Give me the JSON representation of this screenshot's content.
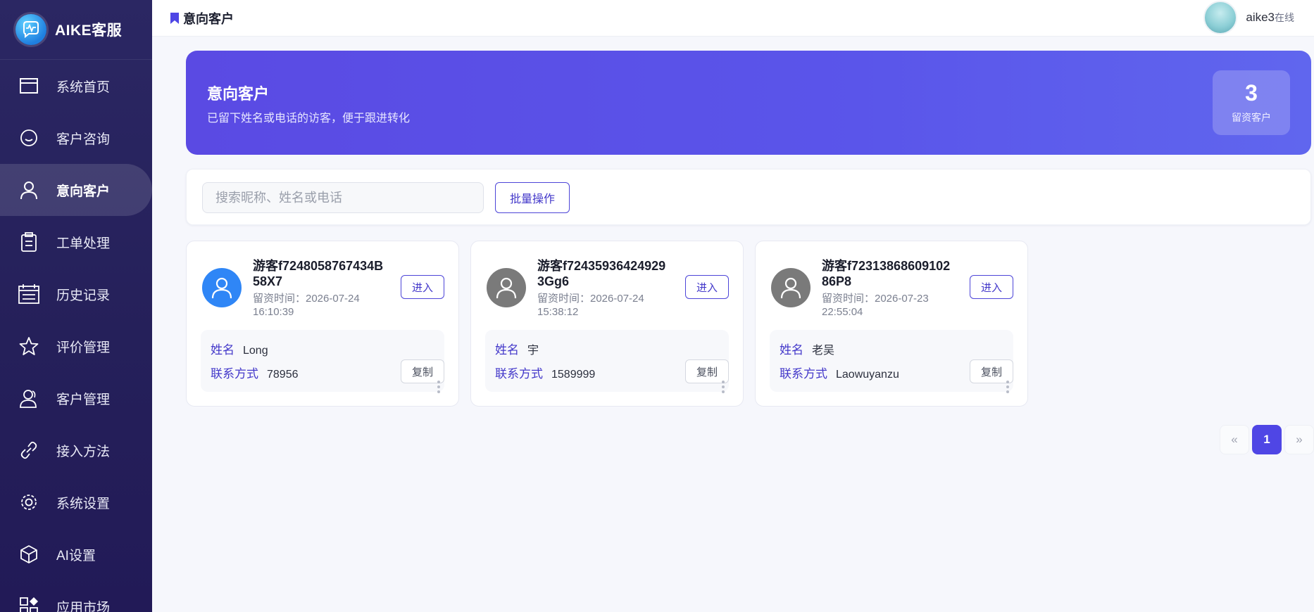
{
  "brand": {
    "name": "AIKE客服"
  },
  "sidebar": {
    "items": [
      {
        "label": "系统首页",
        "icon": "window-icon"
      },
      {
        "label": "客户咨询",
        "icon": "chat-bubble-icon"
      },
      {
        "label": "意向客户",
        "icon": "user-icon",
        "active": true
      },
      {
        "label": "工单处理",
        "icon": "clipboard-icon"
      },
      {
        "label": "历史记录",
        "icon": "calendar-list-icon"
      },
      {
        "label": "评价管理",
        "icon": "star-icon"
      },
      {
        "label": "客户管理",
        "icon": "users-icon"
      },
      {
        "label": "接入方法",
        "icon": "link-icon"
      },
      {
        "label": "系统设置",
        "icon": "gear-icon"
      },
      {
        "label": "AI设置",
        "icon": "cube-icon"
      },
      {
        "label": "应用市场",
        "icon": "apps-icon"
      }
    ]
  },
  "header": {
    "title": "意向客户",
    "user": {
      "name": "aike3",
      "status": "在线"
    }
  },
  "banner": {
    "title": "意向客户",
    "subtitle": "已留下姓名或电话的访客，便于跟进转化",
    "stat_value": "3",
    "stat_label": "留资客户"
  },
  "search": {
    "placeholder": "搜索昵称、姓名或电话",
    "value": "",
    "batch_label": "批量操作"
  },
  "cards": [
    {
      "visitor": "游客f7248058767434B58X7",
      "time": "留资时间：2026-07-24 16:10:39",
      "enter_label": "进入",
      "name_key": "姓名",
      "name_val": "Long",
      "contact_key": "联系方式",
      "contact_val": "78956",
      "copy_label": "复制",
      "avatar_color": "#2f86f6"
    },
    {
      "visitor": "游客f724359364249293Gg6",
      "time": "留资时间：2026-07-24 15:38:12",
      "enter_label": "进入",
      "name_key": "姓名",
      "name_val": "宇",
      "contact_key": "联系方式",
      "contact_val": "1589999",
      "copy_label": "复制",
      "avatar_color": "#7a7a7a"
    },
    {
      "visitor": "游客f7231386860910286P8",
      "time": "留资时间：2026-07-23 22:55:04",
      "enter_label": "进入",
      "name_key": "姓名",
      "name_val": "老吴",
      "contact_key": "联系方式",
      "contact_val": "Laowuyanzu",
      "copy_label": "复制",
      "avatar_color": "#7a7a7a"
    }
  ],
  "pagination": {
    "prev": "«",
    "current": "1",
    "next": "»"
  },
  "colors": {
    "accent": "#4f46e5",
    "sidebar": "#2b2763"
  }
}
